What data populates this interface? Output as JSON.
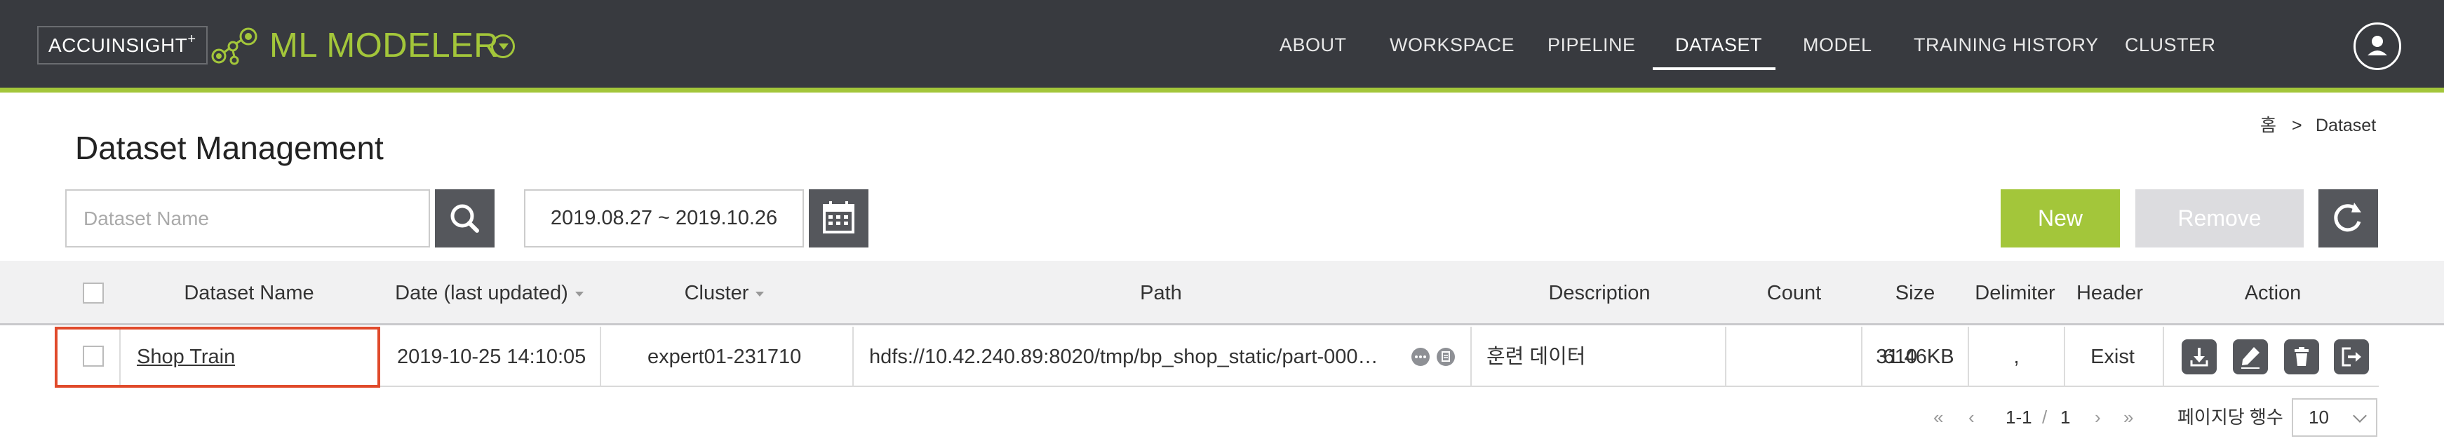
{
  "brand": {
    "name": "ACCUINSIGHT",
    "sup": "+",
    "app_title": "ML MODELER"
  },
  "nav": {
    "items": [
      {
        "label": "ABOUT",
        "active": false
      },
      {
        "label": "WORKSPACE",
        "active": false
      },
      {
        "label": "PIPELINE",
        "active": false
      },
      {
        "label": "DATASET",
        "active": true
      },
      {
        "label": "MODEL",
        "active": false
      },
      {
        "label": "TRAINING HISTORY",
        "active": false
      },
      {
        "label": "CLUSTER",
        "active": false
      }
    ]
  },
  "breadcrumb": {
    "home": "홈",
    "separator": ">",
    "current": "Dataset"
  },
  "page": {
    "title": "Dataset Management"
  },
  "toolbar": {
    "search_placeholder": "Dataset Name",
    "date_range": "2019.08.27 ~ 2019.10.26",
    "new_label": "New",
    "remove_label": "Remove"
  },
  "table": {
    "headers": [
      "Dataset Name",
      "Date (last updated)",
      "Cluster",
      "Path",
      "Description",
      "Count",
      "Size",
      "Delimiter",
      "Header",
      "Action"
    ],
    "rows": [
      {
        "name": "Shop Train",
        "date": "2019-10-25 14:10:05",
        "cluster": "expert01-231710",
        "path": "hdfs://10.42.240.89:8020/tmp/bp_shop_static/part-000…",
        "description": "훈련 데이터",
        "count": "610",
        "size": "31.46KB",
        "delimiter": ",",
        "header": "Exist"
      }
    ]
  },
  "pagination": {
    "range": "1-1",
    "slash": "/",
    "total": "1",
    "rows_per_page_label": "페이지당 행수",
    "rows_per_page": "10",
    "first": "«",
    "prev": "‹",
    "next": "›",
    "last": "»"
  },
  "colors": {
    "topbar": "#383a3f",
    "accent": "#a3c63a",
    "button_dark": "#55575c",
    "highlight": "#e04a2b"
  },
  "icons": [
    "logo-mark-icon",
    "caret-down-icon",
    "user-icon",
    "search-icon",
    "calendar-icon",
    "refresh-icon",
    "more-icon",
    "copy-icon",
    "download-icon",
    "edit-icon",
    "delete-icon",
    "export-icon"
  ]
}
